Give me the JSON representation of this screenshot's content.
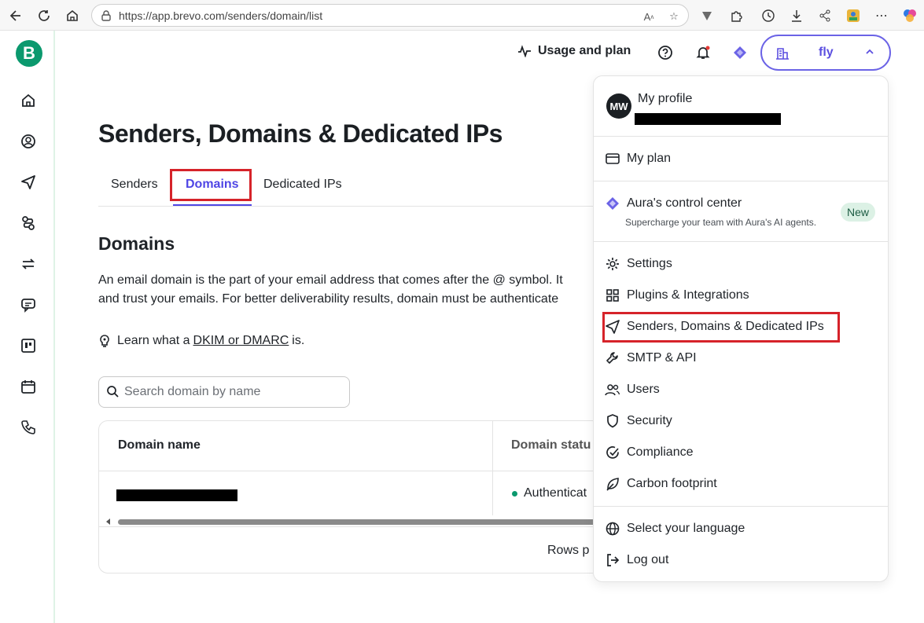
{
  "browser": {
    "url": "https://app.brevo.com/senders/domain/list"
  },
  "sidebar": {
    "logo_letter": "B",
    "items": [
      "home-icon",
      "contacts-icon",
      "campaigns-icon",
      "automations-icon",
      "transactional-icon",
      "conversations-icon",
      "deals-icon",
      "meetings-icon",
      "phone-icon"
    ]
  },
  "topbar": {
    "usage_label": "Usage and plan",
    "account_name": "fly"
  },
  "page": {
    "title": "Senders, Domains & Dedicated IPs",
    "tabs": [
      {
        "label": "Senders",
        "active": false
      },
      {
        "label": "Domains",
        "active": true
      },
      {
        "label": "Dedicated IPs",
        "active": false
      }
    ],
    "section_title": "Domains",
    "description_line1": "An email domain is the part of your email address that comes after the @ symbol. It",
    "description_line2": "and trust your emails. For better deliverability results, domain must be authenticate",
    "learn_prefix": "Learn what a",
    "learn_link": "DKIM or DMARC",
    "learn_suffix": "is.",
    "search_placeholder": "Search domain by name",
    "table": {
      "headers": [
        "Domain name",
        "Domain statu"
      ],
      "rows": [
        {
          "status": "Authenticat"
        }
      ],
      "rows_per_page_label": "Rows p"
    }
  },
  "dropdown": {
    "avatar_initials": "MW",
    "profile_label": "My profile",
    "my_plan": "My plan",
    "aura_title": "Aura's control center",
    "aura_sub": "Supercharge your team with Aura's AI agents.",
    "aura_badge": "New",
    "items": [
      {
        "label": "Settings",
        "icon": "gear-icon"
      },
      {
        "label": "Plugins & Integrations",
        "icon": "grid-icon"
      },
      {
        "label": "Senders, Domains & Dedicated IPs",
        "icon": "send-icon"
      },
      {
        "label": "SMTP & API",
        "icon": "wrench-icon"
      },
      {
        "label": "Users",
        "icon": "users-icon"
      },
      {
        "label": "Security",
        "icon": "shield-icon"
      },
      {
        "label": "Compliance",
        "icon": "check-circle-icon"
      },
      {
        "label": "Carbon footprint",
        "icon": "leaf-icon"
      }
    ],
    "language": "Select your language",
    "logout": "Log out"
  },
  "colors": {
    "brand": "#0b996e",
    "accent": "#4f46e5",
    "highlight": "#d6232a"
  }
}
